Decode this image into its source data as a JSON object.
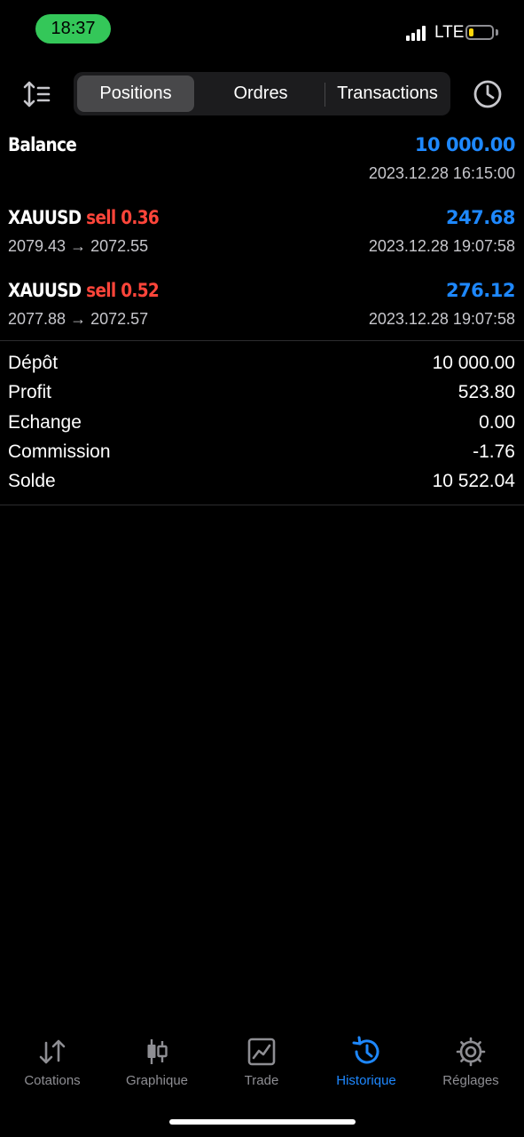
{
  "status": {
    "time": "18:37",
    "network": "LTE",
    "battery_percent": 20,
    "signal_bars": 4
  },
  "toolbar": {
    "tabs": [
      {
        "label": "Positions",
        "active": true
      },
      {
        "label": "Ordres",
        "active": false
      },
      {
        "label": "Transactions",
        "active": false
      }
    ],
    "sort_icon": "sort-icon",
    "history_icon": "clock-icon"
  },
  "balance": {
    "label": "Balance",
    "value": "10 000.00",
    "datetime": "2023.12.28 16:15:00"
  },
  "deals": [
    {
      "symbol": "XAUUSD",
      "side_volume": "sell 0.36",
      "profit": "247.68",
      "prices": "2079.43 → 2072.55",
      "datetime": "2023.12.28 19:07:58"
    },
    {
      "symbol": "XAUUSD",
      "side_volume": "sell 0.52",
      "profit": "276.12",
      "prices": "2077.88 → 2072.57",
      "datetime": "2023.12.28 19:07:58"
    }
  ],
  "summary": [
    {
      "label": "Dépôt",
      "value": "10 000.00"
    },
    {
      "label": "Profit",
      "value": "523.80"
    },
    {
      "label": "Echange",
      "value": "0.00"
    },
    {
      "label": "Commission",
      "value": "-1.76"
    },
    {
      "label": "Solde",
      "value": "10 522.04"
    }
  ],
  "tabbar": [
    {
      "label": "Cotations",
      "icon": "arrows-updown-icon",
      "active": false
    },
    {
      "label": "Graphique",
      "icon": "candlestick-icon",
      "active": false
    },
    {
      "label": "Trade",
      "icon": "chart-line-icon",
      "active": false
    },
    {
      "label": "Historique",
      "icon": "history-icon",
      "active": true
    },
    {
      "label": "Réglages",
      "icon": "gear-icon",
      "active": false
    }
  ],
  "colors": {
    "accent_blue": "#1e88ff",
    "sell_red": "#ff453a",
    "time_pill_green": "#34c759",
    "battery_yellow": "#ffd60a"
  }
}
